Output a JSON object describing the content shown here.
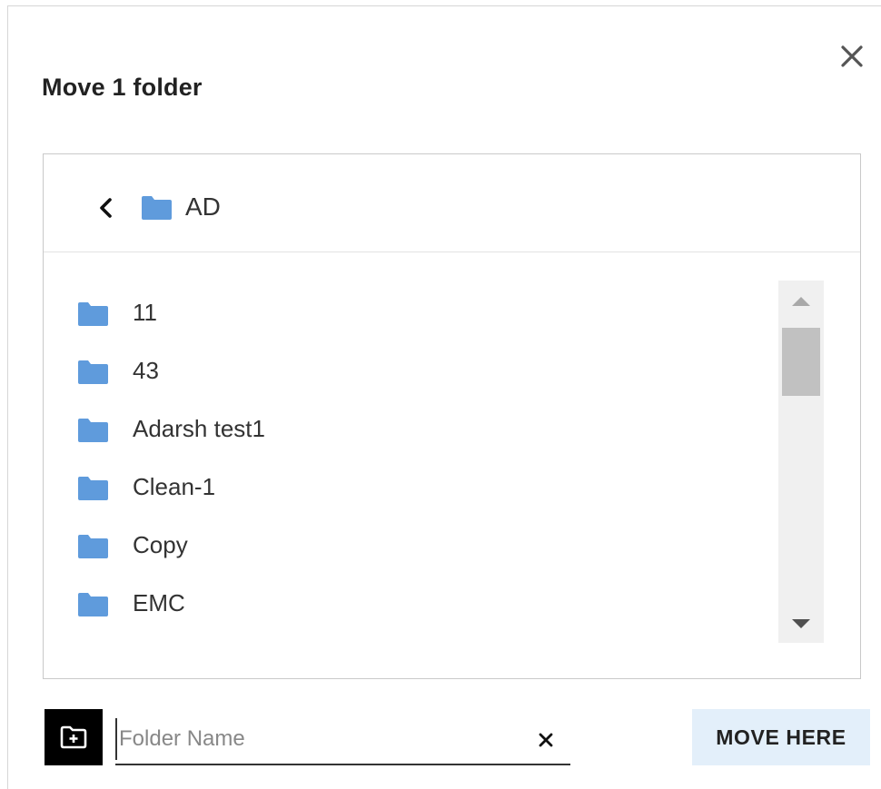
{
  "dialog": {
    "title": "Move 1 folder",
    "close_icon": "close-icon"
  },
  "picker": {
    "back_icon": "chevron-left-icon",
    "current_folder": "AD",
    "folder_icon_color": "#5f9bdc",
    "folders": [
      {
        "name": "11"
      },
      {
        "name": "43"
      },
      {
        "name": "Adarsh test1"
      },
      {
        "name": "Clean-1"
      },
      {
        "name": "Copy"
      },
      {
        "name": "EMC"
      }
    ]
  },
  "footer": {
    "new_folder_icon": "new-folder-icon",
    "folder_name_placeholder": "Folder Name",
    "folder_name_value": "",
    "clear_icon": "close-icon",
    "move_button_label": "MOVE HERE",
    "move_button_bg": "#e3effa"
  }
}
